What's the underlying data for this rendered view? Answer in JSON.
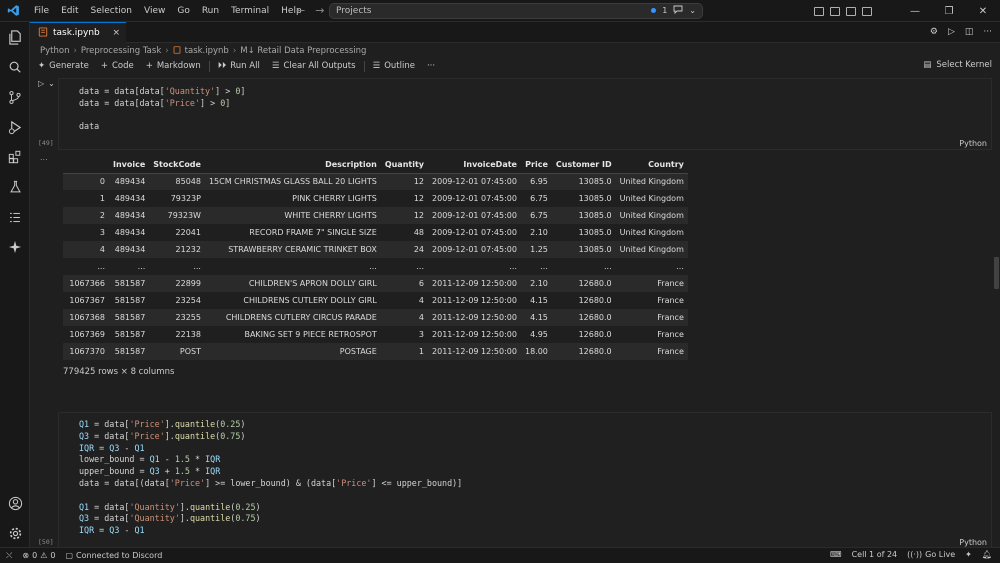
{
  "menu": [
    "File",
    "Edit",
    "Selection",
    "View",
    "Go",
    "Run",
    "Terminal",
    "Help"
  ],
  "command_center": {
    "text": "Projects",
    "badge": "1"
  },
  "tab": {
    "filename": "task.ipynb",
    "close": "×"
  },
  "breadcrumb": [
    "Python",
    "Preprocessing Task",
    "task.ipynb",
    "M↓ Retail Data Preprocessing"
  ],
  "toolbar": {
    "generate": "Generate",
    "code": "Code",
    "markdown": "Markdown",
    "run_all": "Run All",
    "clear_all": "Clear All Outputs",
    "outline": "Outline",
    "more": "···",
    "select_kernel": "Select Kernel"
  },
  "cell1": {
    "exec_count": "[49]",
    "language": "Python",
    "output_dots": "..."
  },
  "dataframe": {
    "columns": [
      "",
      "Invoice",
      "StockCode",
      "Description",
      "Quantity",
      "InvoiceDate",
      "Price",
      "Customer ID",
      "Country"
    ],
    "rows": [
      [
        "0",
        "489434",
        "85048",
        "15CM CHRISTMAS GLASS BALL 20 LIGHTS",
        "12",
        "2009-12-01 07:45:00",
        "6.95",
        "13085.0",
        "United Kingdom"
      ],
      [
        "1",
        "489434",
        "79323P",
        "PINK CHERRY LIGHTS",
        "12",
        "2009-12-01 07:45:00",
        "6.75",
        "13085.0",
        "United Kingdom"
      ],
      [
        "2",
        "489434",
        "79323W",
        "WHITE CHERRY LIGHTS",
        "12",
        "2009-12-01 07:45:00",
        "6.75",
        "13085.0",
        "United Kingdom"
      ],
      [
        "3",
        "489434",
        "22041",
        "RECORD FRAME 7\" SINGLE SIZE",
        "48",
        "2009-12-01 07:45:00",
        "2.10",
        "13085.0",
        "United Kingdom"
      ],
      [
        "4",
        "489434",
        "21232",
        "STRAWBERRY CERAMIC TRINKET BOX",
        "24",
        "2009-12-01 07:45:00",
        "1.25",
        "13085.0",
        "United Kingdom"
      ],
      [
        "...",
        "...",
        "...",
        "...",
        "...",
        "...",
        "...",
        "...",
        "..."
      ],
      [
        "1067366",
        "581587",
        "22899",
        "CHILDREN'S APRON DOLLY GIRL",
        "6",
        "2011-12-09 12:50:00",
        "2.10",
        "12680.0",
        "France"
      ],
      [
        "1067367",
        "581587",
        "23254",
        "CHILDRENS CUTLERY DOLLY GIRL",
        "4",
        "2011-12-09 12:50:00",
        "4.15",
        "12680.0",
        "France"
      ],
      [
        "1067368",
        "581587",
        "23255",
        "CHILDRENS CUTLERY CIRCUS PARADE",
        "4",
        "2011-12-09 12:50:00",
        "4.15",
        "12680.0",
        "France"
      ],
      [
        "1067369",
        "581587",
        "22138",
        "BAKING SET 9 PIECE RETROSPOT",
        "3",
        "2011-12-09 12:50:00",
        "4.95",
        "12680.0",
        "France"
      ],
      [
        "1067370",
        "581587",
        "POST",
        "POSTAGE",
        "1",
        "2011-12-09 12:50:00",
        "18.00",
        "12680.0",
        "France"
      ]
    ],
    "shape": "779425 rows × 8 columns"
  },
  "cell2": {
    "exec_count": "[50]",
    "language": "Python"
  },
  "statusbar": {
    "errors": "0",
    "warnings": "0",
    "discord": "Connected to Discord",
    "cell_pos": "Cell 1 of 24",
    "go_live": "Go Live"
  },
  "colors": {
    "accent": "#0078d4",
    "editor_bg": "#1f1f1f",
    "chrome_bg": "#181818"
  }
}
